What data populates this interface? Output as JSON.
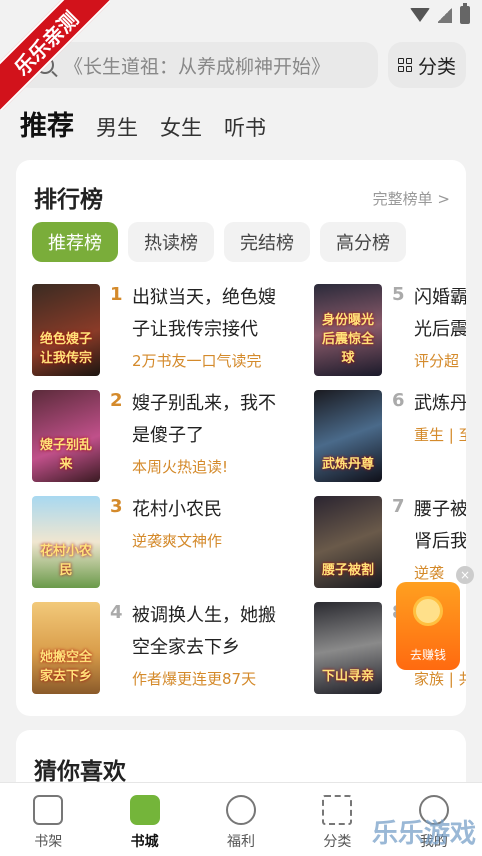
{
  "corner_badge": "乐乐亲测",
  "search": {
    "placeholder": "《长生道祖：从养成柳神开始》",
    "category_label": "分类"
  },
  "top_tabs": [
    "推荐",
    "男生",
    "女生",
    "听书"
  ],
  "ranking": {
    "title": "排行榜",
    "more_label": "完整榜单 >",
    "tabs": [
      "推荐榜",
      "热读榜",
      "完结榜",
      "高分榜"
    ],
    "books": [
      {
        "num": "1",
        "title": "出狱当天，绝色嫂子让我传宗接代",
        "tag": "2万书友一口气读完",
        "cover_text": "绝色嫂子让我传宗"
      },
      {
        "num": "2",
        "title": "嫂子别乱来，我不是傻子了",
        "tag": "本周火热追读!",
        "cover_text": "嫂子别乱来"
      },
      {
        "num": "3",
        "title": "花村小农民",
        "tag": "逆袭爽文神作",
        "cover_text": "花村小农民"
      },
      {
        "num": "4",
        "title": "被调换人生，她搬空全家去下乡",
        "tag": "作者爆更连更87天",
        "cover_text": "她搬空全家去下乡"
      },
      {
        "num": "5",
        "title": "闪婚霸",
        "title2": "光后震",
        "tag": "评分超",
        "cover_text": "身份曝光后震惊全球"
      },
      {
        "num": "6",
        "title": "武炼丹",
        "tag": "重生 | 至",
        "cover_text": "武炼丹尊"
      },
      {
        "num": "7",
        "title": "腰子被",
        "title2": "肾后我",
        "tag": "逆袭",
        "cover_text": "腰子被割"
      },
      {
        "num": "8",
        "title": "",
        "tag": "家族 | 共",
        "cover_text": "下山寻亲"
      }
    ]
  },
  "earn_widget": {
    "label": "去赚钱",
    "close": "×"
  },
  "guess": {
    "title": "猜你喜欢"
  },
  "bottom_nav": [
    "书架",
    "书城",
    "福利",
    "分类",
    "我的"
  ],
  "watermark": "乐乐游戏"
}
